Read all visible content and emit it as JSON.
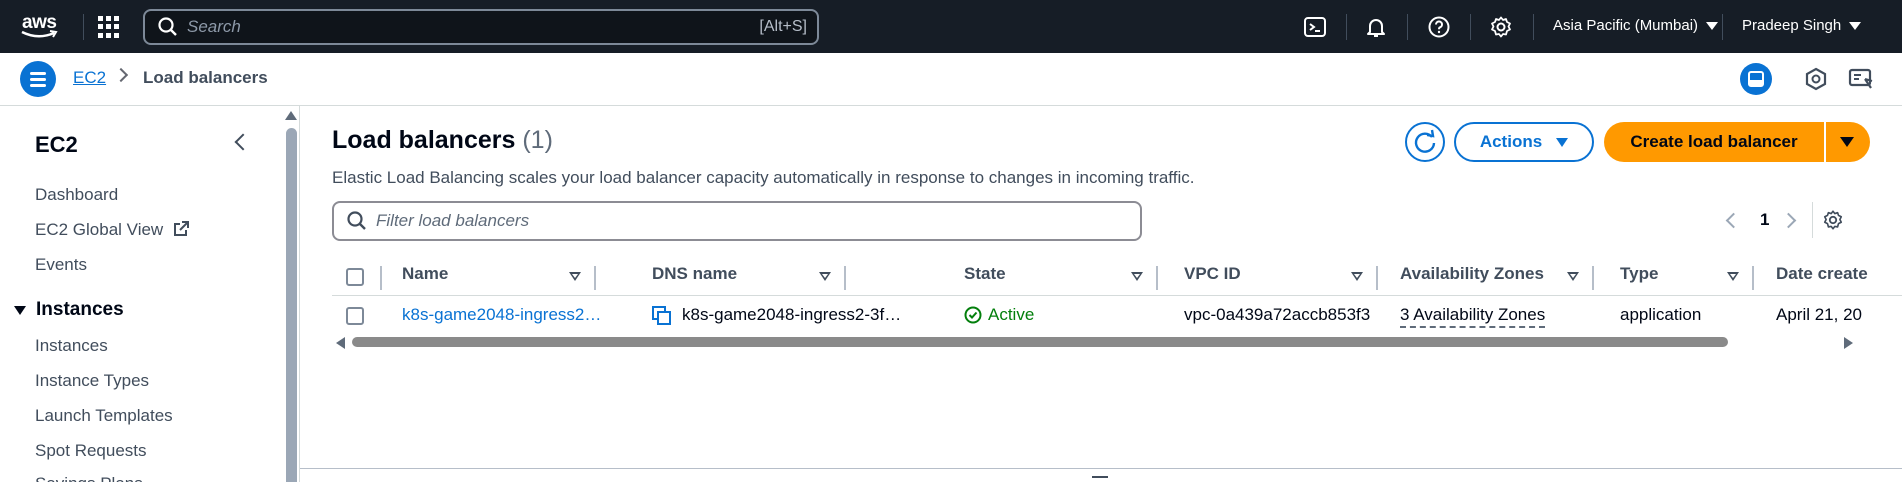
{
  "topnav": {
    "logo_text": "aws",
    "search_placeholder": "Search",
    "search_shortcut": "[Alt+S]",
    "region": "Asia Pacific (Mumbai)",
    "user": "Pradeep Singh",
    "icons": [
      "cloudshell-icon",
      "notifications-icon",
      "help-icon",
      "settings-icon"
    ]
  },
  "breadcrumb": {
    "root": "EC2",
    "current": "Load balancers"
  },
  "sidebar": {
    "title": "EC2",
    "items_top": [
      "Dashboard",
      "EC2 Global View",
      "Events"
    ],
    "section": "Instances",
    "section_items": [
      "Instances",
      "Instance Types",
      "Launch Templates",
      "Spot Requests",
      "Savings Plans"
    ]
  },
  "main": {
    "title": "Load balancers",
    "count": "(1)",
    "description": "Elastic Load Balancing scales your load balancer capacity automatically in response to changes in incoming traffic.",
    "actions_label": "Actions",
    "create_label": "Create load balancer",
    "filter_placeholder": "Filter load balancers",
    "page_number": "1"
  },
  "table": {
    "columns": [
      "Name",
      "DNS name",
      "State",
      "VPC ID",
      "Availability Zones",
      "Type",
      "Date create"
    ],
    "rows": [
      {
        "name": "k8s-game2048-ingress2…",
        "dns": "k8s-game2048-ingress2-3f…",
        "state": "Active",
        "vpc": "vpc-0a439a72accb853f3",
        "azs": "3 Availability Zones",
        "type": "application",
        "date": "April 21, 20"
      }
    ]
  },
  "colors": {
    "nav_bg": "#161d26",
    "link_blue": "#0972d3",
    "primary_orange": "#ff9900",
    "status_green": "#037f0c"
  }
}
